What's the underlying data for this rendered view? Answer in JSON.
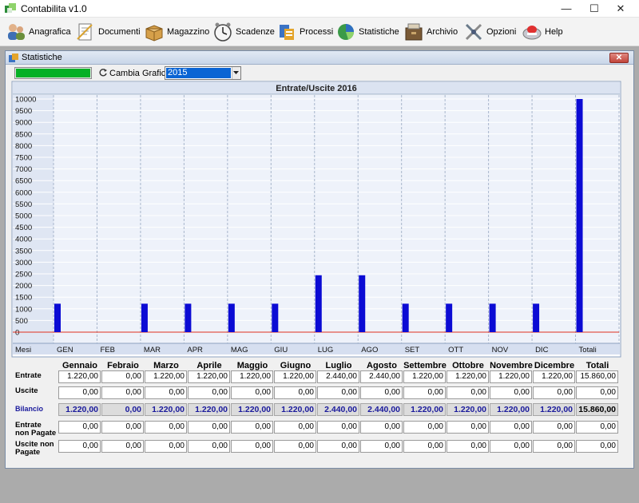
{
  "window": {
    "title": "Contabilita v1.0",
    "controls": {
      "minimize": "—",
      "maximize": "☐",
      "close": "✕"
    }
  },
  "toolbar": {
    "items": [
      {
        "label": "Anagrafica",
        "icon": "people-icon"
      },
      {
        "label": "Documenti",
        "icon": "document-icon"
      },
      {
        "label": "Magazzino",
        "icon": "box-icon"
      },
      {
        "label": "Scadenze",
        "icon": "clock-icon"
      },
      {
        "label": "Processi",
        "icon": "process-icon"
      },
      {
        "label": "Statistiche",
        "icon": "chart-icon"
      },
      {
        "label": "Archivio",
        "icon": "archive-icon"
      },
      {
        "label": "Opzioni",
        "icon": "options-icon"
      },
      {
        "label": "Help",
        "icon": "help-icon"
      }
    ]
  },
  "subwindow": {
    "title": "Statistiche",
    "close": "✕",
    "progress": 1.0,
    "cambia_label": "Cambia Grafica",
    "year_selected": "2015"
  },
  "colors": {
    "bar": "#0b0bd4",
    "zero_line": "#e0301e",
    "plot_bg": "#eef2fa",
    "header_bg": "#dbe3f1",
    "accent": "#1a1a9c"
  },
  "chart_data": {
    "type": "bar",
    "title": "Entrate/Uscite 2016",
    "category_axis_label": "Mesi",
    "categories": [
      "GEN",
      "FEB",
      "MAR",
      "APR",
      "MAG",
      "GIU",
      "LUG",
      "AGO",
      "SET",
      "OTT",
      "NOV",
      "DIC",
      "Totali"
    ],
    "values": [
      1220,
      0,
      1220,
      1220,
      1220,
      1220,
      2440,
      2440,
      1220,
      1220,
      1220,
      1220,
      10000
    ],
    "ylim": [
      0,
      10000
    ],
    "yticks": [
      0,
      500,
      1000,
      1500,
      2000,
      2500,
      3000,
      3500,
      4000,
      4500,
      5000,
      5500,
      6000,
      6500,
      7000,
      7500,
      8000,
      8500,
      9000,
      9500,
      10000
    ],
    "grid": true
  },
  "table": {
    "columns": [
      "Gennaio",
      "Febraio",
      "Marzo",
      "Aprile",
      "Maggio",
      "Giugno",
      "Luglio",
      "Agosto",
      "Settembre",
      "Ottobre",
      "Novembre",
      "Dicembre",
      "Totali"
    ],
    "rows": [
      {
        "label": "Entrate",
        "values": [
          "1.220,00",
          "0,00",
          "1.220,00",
          "1.220,00",
          "1.220,00",
          "1.220,00",
          "2.440,00",
          "2.440,00",
          "1.220,00",
          "1.220,00",
          "1.220,00",
          "1.220,00",
          "15.860,00"
        ]
      },
      {
        "label": "Uscite",
        "values": [
          "0,00",
          "0,00",
          "0,00",
          "0,00",
          "0,00",
          "0,00",
          "0,00",
          "0,00",
          "0,00",
          "0,00",
          "0,00",
          "0,00",
          "0,00"
        ]
      },
      {
        "label": "Bilancio",
        "values": [
          "1.220,00",
          "0,00",
          "1.220,00",
          "1.220,00",
          "1.220,00",
          "1.220,00",
          "2.440,00",
          "2.440,00",
          "1.220,00",
          "1.220,00",
          "1.220,00",
          "1.220,00",
          "15.860,00"
        ]
      },
      {
        "label": "Entrate non Pagate",
        "values": [
          "0,00",
          "0,00",
          "0,00",
          "0,00",
          "0,00",
          "0,00",
          "0,00",
          "0,00",
          "0,00",
          "0,00",
          "0,00",
          "0,00",
          "0,00"
        ]
      },
      {
        "label": "Uscite non Pagate",
        "values": [
          "0,00",
          "0,00",
          "0,00",
          "0,00",
          "0,00",
          "0,00",
          "0,00",
          "0,00",
          "0,00",
          "0,00",
          "0,00",
          "0,00",
          "0,00"
        ]
      }
    ]
  }
}
